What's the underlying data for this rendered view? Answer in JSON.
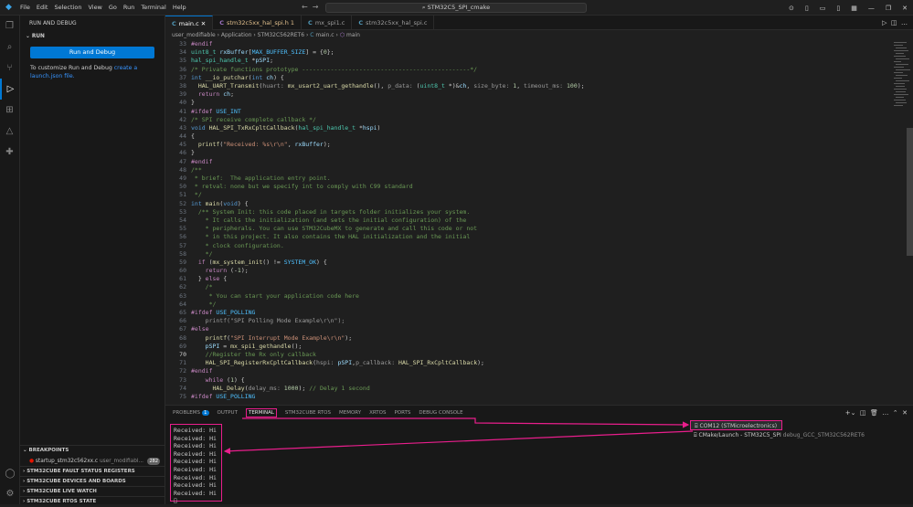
{
  "titlebar": {
    "menu": [
      "File",
      "Edit",
      "Selection",
      "View",
      "Go",
      "Run",
      "Terminal",
      "Help"
    ],
    "search": "STM32C5_SPI_cmake"
  },
  "sidebar": {
    "header": "RUN AND DEBUG",
    "run_section": "RUN",
    "run_button": "Run and Debug",
    "customize_text": "To customize Run and Debug ",
    "create_link": "create a launch.json file.",
    "sections": {
      "breakpoints": "BREAKPOINTS",
      "fault": "STM32CUBE FAULT STATUS REGISTERS",
      "devices": "STM32CUBE DEVICES AND BOARDS",
      "watch": "STM32CUBE LIVE WATCH",
      "rtos": "STM32CUBE RTOS STATE"
    },
    "breakpoint_item": {
      "file": "startup_stm32c562xx.c",
      "path": "user_modifiabl...",
      "line": "282"
    }
  },
  "tabs": [
    {
      "label": "main.c",
      "active": true
    },
    {
      "label": "stm32c5xx_hal_spi.h 1",
      "modified": true
    },
    {
      "label": "mx_spi1.c"
    },
    {
      "label": "stm32c5xx_hal_spi.c"
    }
  ],
  "breadcrumb": {
    "parts": [
      "user_modifiable",
      "Application",
      "STM32C562RET6",
      "main.c",
      "main"
    ]
  },
  "current_line": "70",
  "panel": {
    "tabs": [
      {
        "label": "PROBLEMS",
        "count": "1"
      },
      {
        "label": "OUTPUT"
      },
      {
        "label": "TERMINAL",
        "active": true
      },
      {
        "label": "STM32CUBE RTOS"
      },
      {
        "label": "MEMORY"
      },
      {
        "label": "XRTOS"
      },
      {
        "label": "PORTS"
      },
      {
        "label": "DEBUG CONSOLE"
      }
    ],
    "terminal_output": [
      "Received: Hi",
      "Received: Hi",
      "Received: Hi",
      "Received: Hi",
      "Received: Hi",
      "Received: Hi",
      "Received: Hi",
      "Received: Hi",
      "Received: Hi"
    ],
    "prompt": "▯",
    "terminal_list": [
      {
        "label": "COM12 (STMicroelectronics)",
        "selected": true
      },
      {
        "label": "CMake/Launch - STM32C5_SPI",
        "detail": "debug_GCC_STM32C562RET6"
      }
    ]
  },
  "code": [
    {
      "n": "33",
      "html": "<span class='pp'>#endif</span>"
    },
    {
      "n": "34",
      "html": "<span class='ty'>uint8_t</span> <span class='va'>rxBuffer</span>[<span class='mc'>MAX_BUFFER_SIZE</span>] = {<span class='nm'>0</span>};"
    },
    {
      "n": "35",
      "html": "<span class='ty'>hal_spi_handle_t</span> *<span class='va'>pSPI</span>;"
    },
    {
      "n": "36",
      "html": "<span class='cm'>/* Private functions prototype -----------------------------------------------*/</span>"
    },
    {
      "n": "37",
      "html": "<span class='kw'>int</span> <span class='fn'>__io_putchar</span>(<span class='kw'>int</span> <span class='va'>ch</span>) {"
    },
    {
      "n": "38",
      "html": "  <span class='fn'>HAL_UART_Transmit</span>(<span class='hn'>huart:</span> <span class='fn'>mx_usart2_uart_gethandle</span>(), <span class='hn'>p_data:</span> (<span class='ty'>uint8_t</span> *)&amp;<span class='va'>ch</span>, <span class='hn'>size_byte:</span> <span class='nm'>1</span>, <span class='hn'>timeout_ms:</span> <span class='nm'>100</span>);"
    },
    {
      "n": "39",
      "html": "  <span class='pp'>return</span> <span class='va'>ch</span>;"
    },
    {
      "n": "40",
      "html": "}"
    },
    {
      "n": "41",
      "html": "<span class='pp'>#ifdef</span> <span class='mc'>USE_INT</span>"
    },
    {
      "n": "42",
      "html": "<span class='cm'>/* SPI receive complete callback */</span>"
    },
    {
      "n": "43",
      "html": "<span class='kw'>void</span> <span class='fn'>HAL_SPI_TxRxCpltCallback</span>(<span class='ty'>hal_spi_handle_t</span> *<span class='va'>hspi</span>)"
    },
    {
      "n": "44",
      "html": "{"
    },
    {
      "n": "45",
      "html": "  <span class='fn'>printf</span>(<span class='st'>\"Received: %s\\r\\n\"</span>, <span class='va'>rxBuffer</span>);"
    },
    {
      "n": "46",
      "html": "}"
    },
    {
      "n": "47",
      "html": "<span class='pp'>#endif</span>"
    },
    {
      "n": "48",
      "html": "<span class='cm'>/**</span>"
    },
    {
      "n": "49",
      "html": "<span class='cm'> * brief:  The application entry point.</span>"
    },
    {
      "n": "50",
      "html": "<span class='cm'> * retval: none but we specify int to comply with C99 standard</span>"
    },
    {
      "n": "51",
      "html": "<span class='cm'> */</span>"
    },
    {
      "n": "52",
      "html": "<span class='kw'>int</span> <span class='fn'>main</span>(<span class='kw'>void</span>) {"
    },
    {
      "n": "53",
      "html": "  <span class='cm'>/** System Init: this code placed in targets folder initializes your system.</span>"
    },
    {
      "n": "54",
      "html": "<span class='cm'>    * It calls the initialization (and sets the initial configuration) of the</span>"
    },
    {
      "n": "55",
      "html": "<span class='cm'>    * peripherals. You can use STM32CubeMX to generate and call this code or not</span>"
    },
    {
      "n": "56",
      "html": "<span class='cm'>    * in this project. It also contains the HAL initialization and the initial</span>"
    },
    {
      "n": "57",
      "html": "<span class='cm'>    * clock configuration.</span>"
    },
    {
      "n": "58",
      "html": "<span class='cm'>    */</span>"
    },
    {
      "n": "59",
      "html": "  <span class='pp'>if</span> (<span class='fn'>mx_system_init</span>() != <span class='mc'>SYSTEM_OK</span>) {"
    },
    {
      "n": "60",
      "html": "    <span class='pp'>return</span> (-<span class='nm'>1</span>);"
    },
    {
      "n": "61",
      "html": "  } <span class='pp'>else</span> {"
    },
    {
      "n": "62",
      "html": "<span class='cm'>    /*</span>"
    },
    {
      "n": "63",
      "html": "<span class='cm'>     * You can start your application code here</span>"
    },
    {
      "n": "64",
      "html": "<span class='cm'>     */</span>"
    },
    {
      "n": "65",
      "html": "<span class='pp'>#ifdef</span> <span class='mc'>USE_POLLING</span>"
    },
    {
      "n": "66",
      "html": "    <span class='hn'>printf(\"SPI Polling Mode Example\\r\\n\");</span>"
    },
    {
      "n": "67",
      "html": "<span class='pp'>#else</span>"
    },
    {
      "n": "68",
      "html": "    <span class='fn'>printf</span>(<span class='st'>\"SPI Interrupt Mode Example\\r\\n\"</span>);"
    },
    {
      "n": "69",
      "html": "    <span class='va'>pSPI</span> = <span class='fn'>mx_spi1_gethandle</span>();"
    },
    {
      "n": "70",
      "html": "    <span class='cm'>//Register the Rx only callback</span>"
    },
    {
      "n": "71",
      "html": "    <span class='fn'>HAL_SPI_RegisterRxCpltCallback</span>(<span class='hn'>hspi:</span> <span class='va'>pSPI</span>,<span class='hn'>p_callback:</span> <span class='fn'>HAL_SPI_RxCpltCallback</span>);"
    },
    {
      "n": "72",
      "html": "<span class='pp'>#endif</span>"
    },
    {
      "n": "73",
      "html": "    <span class='pp'>while</span> (<span class='nm'>1</span>) {"
    },
    {
      "n": "74",
      "html": "      <span class='fn'>HAL_Delay</span>(<span class='hn'>delay_ms:</span> <span class='nm'>1000</span>); <span class='cm'>// Delay 1 second</span>"
    },
    {
      "n": "75",
      "html": "<span class='pp'>#ifdef</span> <span class='mc'>USE_POLLING</span>"
    }
  ],
  "colors": {
    "accent": "#0078d4",
    "highlight": "#e91e8c"
  }
}
